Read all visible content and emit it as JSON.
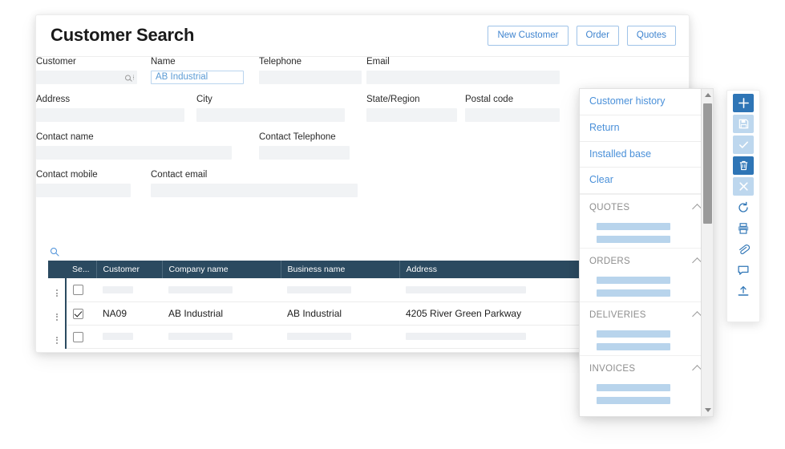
{
  "header": {
    "title": "Customer Search",
    "buttons": [
      {
        "label": "New Customer",
        "name": "new-customer-button"
      },
      {
        "label": "Order",
        "name": "order-button"
      },
      {
        "label": "Quotes",
        "name": "quotes-button"
      }
    ]
  },
  "form": {
    "fields": [
      {
        "label": "Customer",
        "value": "",
        "filled": false,
        "icons": true
      },
      {
        "label": "Name",
        "value": "AB Industrial",
        "filled": true,
        "icons": false
      },
      {
        "label": "Telephone",
        "value": "",
        "filled": false,
        "icons": false
      },
      {
        "label": "Email",
        "value": "",
        "filled": false,
        "icons": false
      },
      {
        "label": "Address",
        "value": "",
        "filled": false,
        "icons": false
      },
      {
        "label": "City",
        "value": "",
        "filled": false,
        "icons": false
      },
      {
        "label": "State/Region",
        "value": "",
        "filled": false,
        "icons": false
      },
      {
        "label": "Postal code",
        "value": "",
        "filled": false,
        "icons": false
      },
      {
        "label": "Contact name",
        "value": "",
        "filled": false,
        "icons": false
      },
      {
        "label": "Contact Telephone",
        "value": "",
        "filled": false,
        "icons": false
      },
      {
        "label": "Contact mobile",
        "value": "",
        "filled": false,
        "icons": false
      },
      {
        "label": "Contact email",
        "value": "",
        "filled": false,
        "icons": false
      }
    ]
  },
  "table": {
    "columns": [
      "Se...",
      "Customer",
      "Company name",
      "Business name",
      "Address"
    ],
    "rows": [
      {
        "selected": false,
        "placeholder": true,
        "customer": "",
        "company": "",
        "business": "",
        "address": ""
      },
      {
        "selected": true,
        "placeholder": false,
        "customer": "NA09",
        "company": "AB Industrial",
        "business": "AB Industrial",
        "address": "4205 River Green Parkway"
      },
      {
        "selected": false,
        "placeholder": true,
        "customer": "",
        "company": "",
        "business": "",
        "address": ""
      }
    ]
  },
  "panel": {
    "links": [
      {
        "label": "Customer history",
        "name": "panel-link-customer-history"
      },
      {
        "label": "Return",
        "name": "panel-link-return"
      },
      {
        "label": "Installed base",
        "name": "panel-link-installed-base"
      },
      {
        "label": "Clear",
        "name": "panel-link-clear"
      }
    ],
    "sections": [
      {
        "label": "QUOTES",
        "name": "panel-section-quotes",
        "bars": 2
      },
      {
        "label": "ORDERS",
        "name": "panel-section-orders",
        "bars": 2
      },
      {
        "label": "DELIVERIES",
        "name": "panel-section-deliveries",
        "bars": 2
      },
      {
        "label": "INVOICES",
        "name": "panel-section-invoices",
        "bars": 2
      }
    ]
  },
  "toolbar": {
    "items": [
      {
        "icon": "plus-icon",
        "style": "solid"
      },
      {
        "icon": "save-icon",
        "style": "pale"
      },
      {
        "icon": "check-icon",
        "style": "pale"
      },
      {
        "icon": "trash-icon",
        "style": "solid"
      },
      {
        "icon": "close-icon",
        "style": "pale"
      },
      {
        "icon": "refresh-icon",
        "style": "plain"
      },
      {
        "icon": "print-icon",
        "style": "plain"
      },
      {
        "icon": "paperclip-icon",
        "style": "plain"
      },
      {
        "icon": "comment-icon",
        "style": "plain"
      },
      {
        "icon": "upload-icon",
        "style": "plain"
      }
    ]
  },
  "colors": {
    "accent_blue": "#4a90d9",
    "header_navy": "#2b4a60",
    "solid_icon": "#2e75b6",
    "pale_icon": "#bdd7ee",
    "bar_blue": "#b8d4ec"
  }
}
